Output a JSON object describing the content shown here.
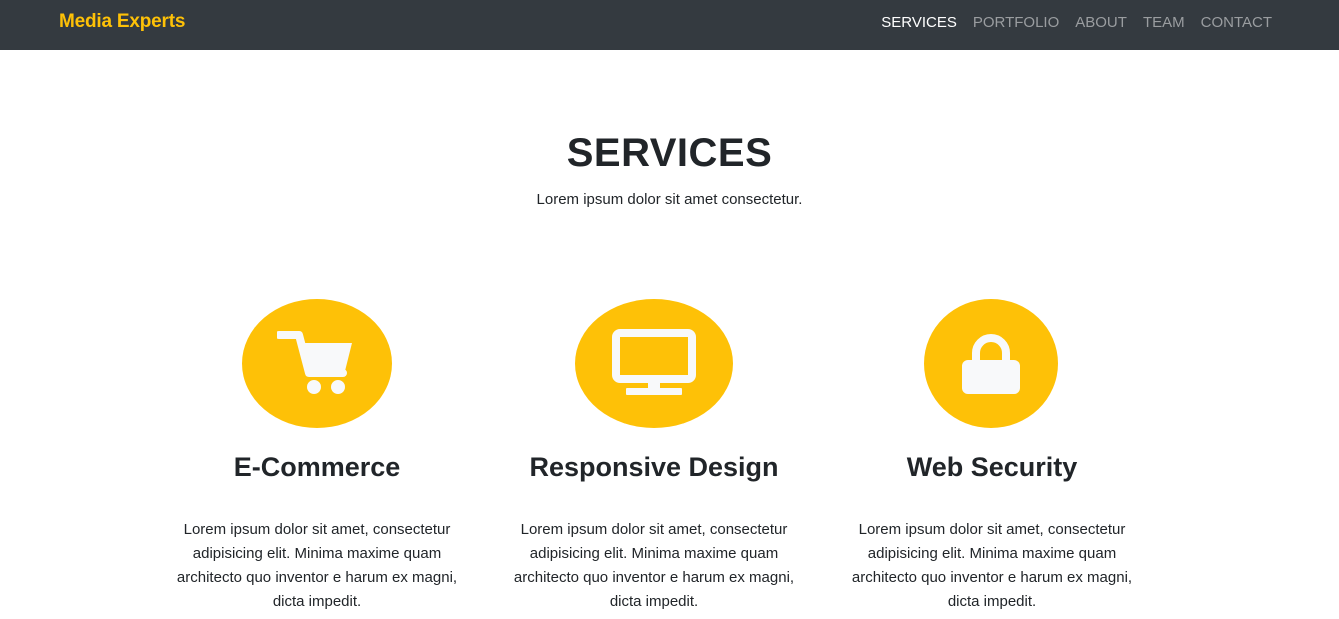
{
  "navbar": {
    "brand": "Media Experts",
    "links": [
      "SERVICES",
      "PORTFOLIO",
      "ABOUT",
      "TEAM",
      "CONTACT"
    ]
  },
  "services": {
    "title": "SERVICES",
    "subtitle": "Lorem ipsum dolor sit amet consectetur.",
    "items": [
      {
        "icon": "shopping-cart-icon",
        "title": "E-Commerce",
        "text": "Lorem ipsum dolor sit amet, consectetur adipisicing elit. Minima maxime quam architecto quo inventor e harum ex magni, dicta impedit."
      },
      {
        "icon": "desktop-icon",
        "title": "Responsive Design",
        "text": "Lorem ipsum dolor sit amet, consectetur adipisicing elit. Minima maxime quam architecto quo inventor e harum ex magni, dicta impedit."
      },
      {
        "icon": "lock-icon",
        "title": "Web Security",
        "text": "Lorem ipsum dolor sit amet, consectetur adipisicing elit. Minima maxime quam architecto quo inventor e harum ex magni, dicta impedit."
      }
    ]
  },
  "colors": {
    "navbar_bg": "#343a40",
    "accent": "#fec107",
    "icon_fill": "#f8f9fa",
    "text": "#212529"
  }
}
